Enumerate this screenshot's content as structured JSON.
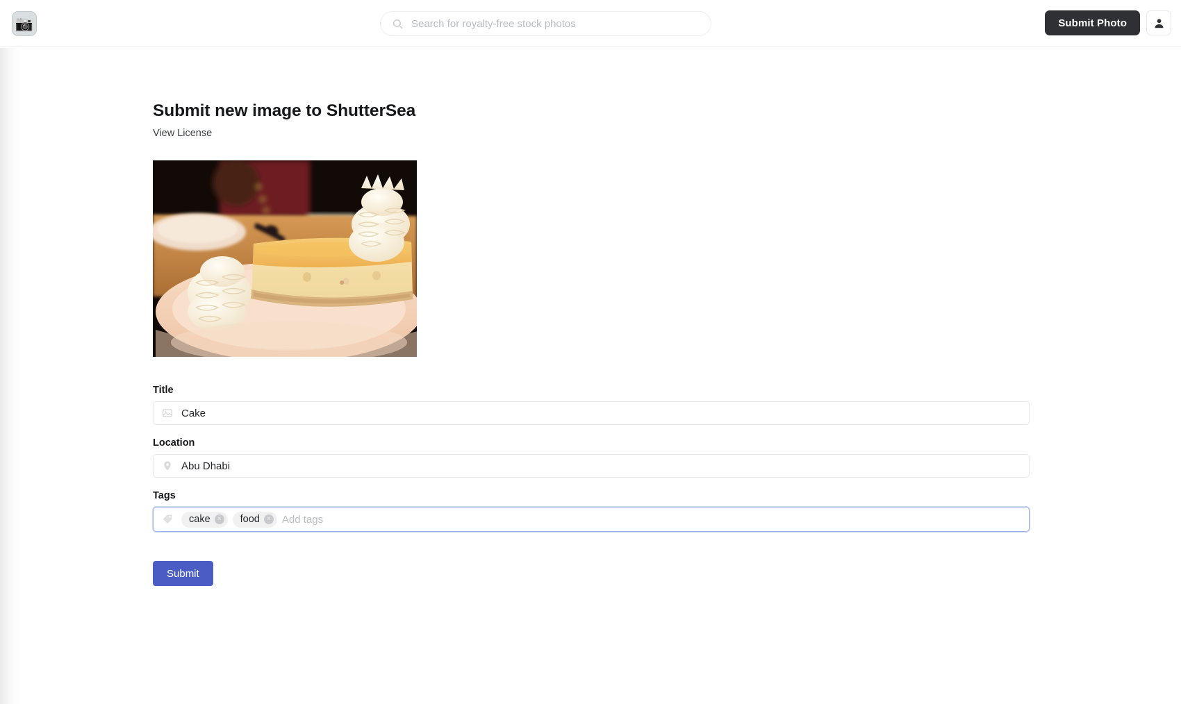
{
  "header": {
    "logo_icon": "camera-icon",
    "logo_glyph": "📷",
    "search": {
      "icon": "search-icon",
      "placeholder": "Search for royalty-free stock photos",
      "value": ""
    },
    "submit_photo_label": "Submit Photo",
    "account_icon": "user-icon"
  },
  "main": {
    "title": "Submit new image to ShutterSea",
    "license_link": "View License",
    "preview": {
      "alt": "slice of cheesecake with whipped cream on a plate",
      "colors": {
        "background": "#120a06",
        "plate": "#f3cdb4",
        "table": "#c98a4c",
        "cake_top": "#f0b95c",
        "cake_body": "#f3dda8",
        "cream": "#fdf6e6",
        "shirt": "#701c22"
      }
    },
    "fields": {
      "title": {
        "label": "Title",
        "icon": "image-icon",
        "value": "Cake",
        "placeholder": "Title"
      },
      "location": {
        "label": "Location",
        "icon": "map-pin-icon",
        "value": "Abu Dhabi",
        "placeholder": "Location"
      },
      "tags": {
        "label": "Tags",
        "icon": "tag-icon",
        "placeholder": "Add tags",
        "value": "",
        "focused": true,
        "chips": [
          {
            "label": "cake",
            "remove": "×"
          },
          {
            "label": "food",
            "remove": "×"
          }
        ]
      }
    },
    "submit_label": "Submit"
  },
  "colors": {
    "accent": "#4c5cc5",
    "header_button": "#2e3033",
    "focus_border": "#9fb4e8",
    "border": "#e4e6e9"
  }
}
